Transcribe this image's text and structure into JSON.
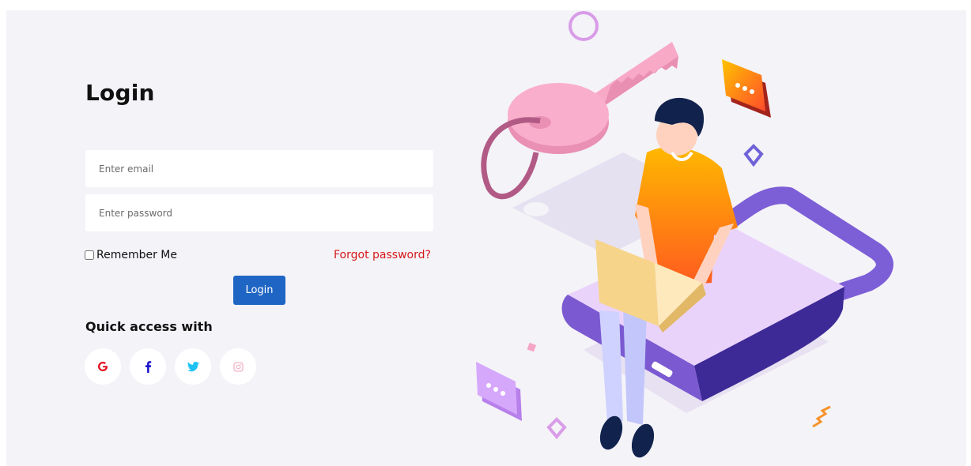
{
  "login": {
    "title": "Login",
    "email_placeholder": "Enter email",
    "password_placeholder": "Enter password",
    "remember_label": "Remember Me",
    "forgot_label": "Forgot password?",
    "login_button": "Login",
    "quick_access_label": "Quick access with"
  },
  "social": [
    {
      "name": "google",
      "icon": "google-icon",
      "color": "#e3101c"
    },
    {
      "name": "facebook",
      "icon": "facebook-icon",
      "color": "#1a12c9"
    },
    {
      "name": "twitter",
      "icon": "twitter-icon",
      "color": "#1ec2f2"
    },
    {
      "name": "instagram",
      "icon": "instagram-icon",
      "color": "#f3b4c6"
    }
  ],
  "colors": {
    "background": "#f4f3f8",
    "primary_button": "#1f66c4",
    "forgot_link": "#d71818"
  }
}
